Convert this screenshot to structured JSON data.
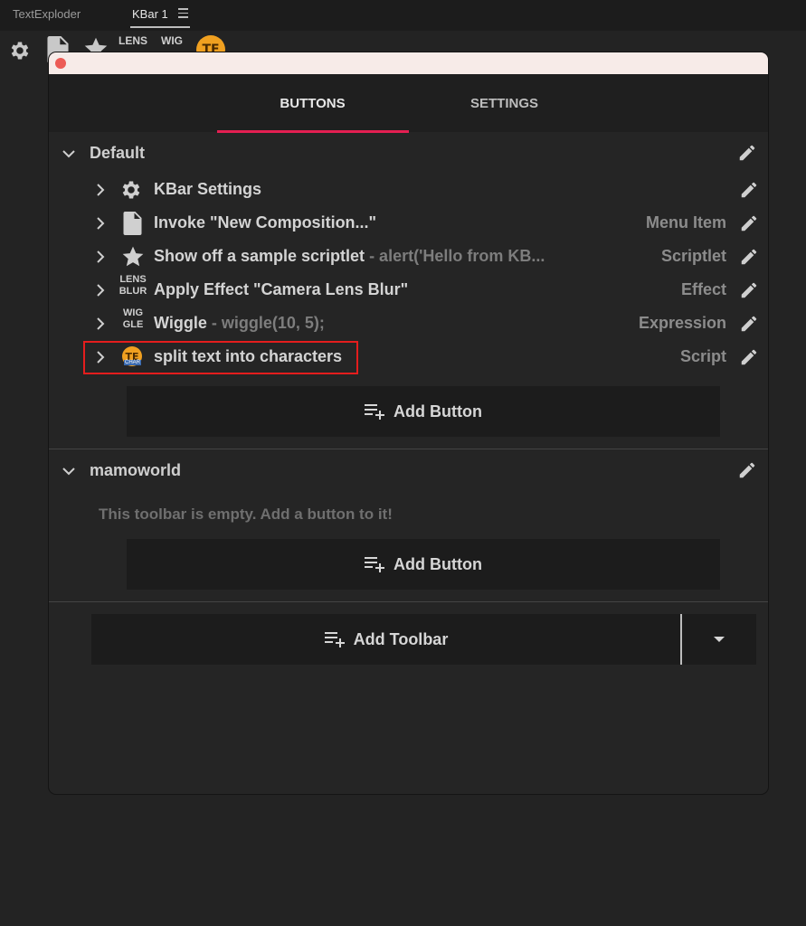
{
  "panel_tabs": [
    {
      "label": "TextExploder"
    },
    {
      "label": "KBar 1"
    }
  ],
  "kbar": {
    "lens_label": "LENS",
    "wig_label": "WIG",
    "te_badge": "TE"
  },
  "dialog": {
    "tabs": [
      {
        "label": "BUTTONS",
        "active": true
      },
      {
        "label": "SETTINGS",
        "active": false
      }
    ],
    "toolbars": [
      {
        "name": "Default",
        "buttons": [
          {
            "label": "KBar Settings",
            "sub": "",
            "type": ""
          },
          {
            "label": "Invoke \"New Composition...\"",
            "sub": "",
            "type": "Menu Item"
          },
          {
            "label": "Show off a sample scriptlet",
            "sub": " - alert('Hello from KB...",
            "type": "Scriptlet"
          },
          {
            "label": "Apply Effect \"Camera Lens Blur\"",
            "sub": "",
            "type": "Effect",
            "icon_text": [
              "LENS",
              "BLUR"
            ]
          },
          {
            "label": "Wiggle",
            "sub": " - wiggle(10, 5);",
            "type": "Expression",
            "icon_text": [
              "WIG",
              "GLE"
            ]
          },
          {
            "label": "split text into characters",
            "sub": "",
            "type": "Script",
            "icon_text": [
              "TE",
              "CHAR"
            ]
          }
        ],
        "add_button_label": "Add Button"
      },
      {
        "name": "mamoworld",
        "empty_message": "This toolbar is empty. Add a button to it!",
        "add_button_label": "Add Button"
      }
    ],
    "add_toolbar_label": "Add Toolbar"
  },
  "colors": {
    "accent": "#e41f52",
    "highlight_box": "#e41d1d",
    "te_badge": "#f0a020",
    "close_dot": "#ec5b55"
  }
}
